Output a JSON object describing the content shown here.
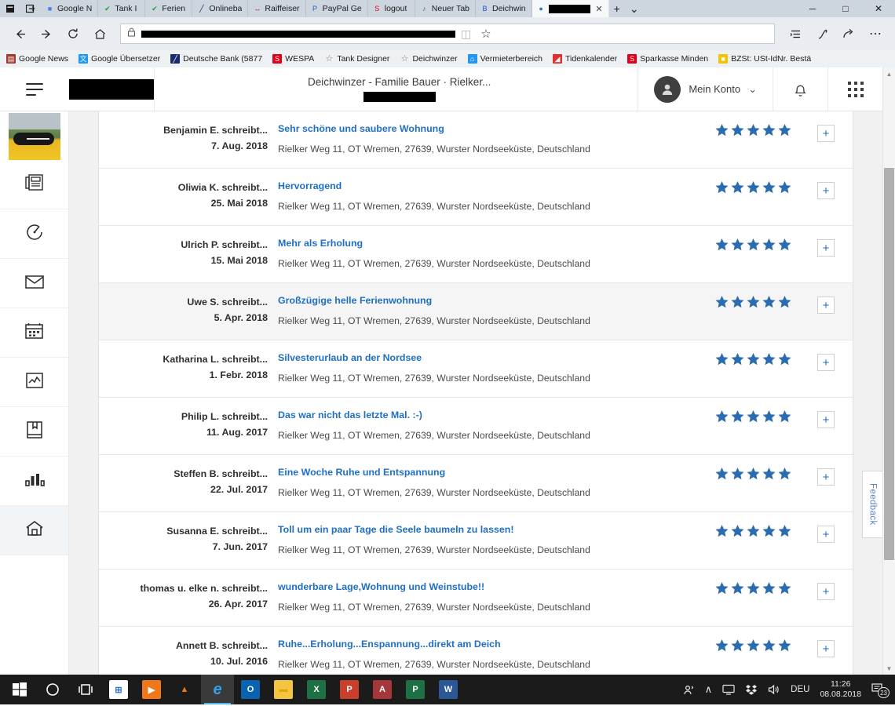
{
  "browser": {
    "tabs": [
      {
        "title": "Google N",
        "icon": "google-icon",
        "icon_color": "#4285f4",
        "glyph": "■",
        "active": false,
        "redacted": false
      },
      {
        "title": "Tank I",
        "icon": "checkmark-icon",
        "icon_color": "#1a9e3c",
        "glyph": "✔",
        "active": false,
        "redacted": false
      },
      {
        "title": "Ferien",
        "icon": "checkmark-icon",
        "icon_color": "#1a9e3c",
        "glyph": "✔",
        "active": false,
        "redacted": false
      },
      {
        "title": "Onlineba",
        "icon": "deutsche-bank-icon",
        "icon_color": "#1a2a6c",
        "glyph": "╱",
        "active": false,
        "redacted": false
      },
      {
        "title": "Raiffeiser",
        "icon": "raiffeisen-icon",
        "icon_color": "#c8102e",
        "glyph": "↔",
        "active": false,
        "redacted": false
      },
      {
        "title": "PayPal Ge",
        "icon": "paypal-icon",
        "icon_color": "#1565c0",
        "glyph": "P",
        "active": false,
        "redacted": false
      },
      {
        "title": "logout",
        "icon": "sparkasse-icon",
        "icon_color": "#e2001a",
        "glyph": "S",
        "active": false,
        "redacted": false
      },
      {
        "title": "Neuer Tab",
        "icon": "page-icon",
        "icon_color": "#5c5c5c",
        "glyph": "♪",
        "active": false,
        "redacted": false
      },
      {
        "title": "Deichwin",
        "icon": "booking-icon",
        "icon_color": "#1d4ed8",
        "glyph": "B",
        "active": false,
        "redacted": false
      },
      {
        "title": "",
        "icon": "redacted-icon",
        "icon_color": "#2b7bbd",
        "glyph": "●",
        "active": true,
        "redacted": true
      }
    ],
    "tab_close_glyph": "✕",
    "new_tab_glyph": "+",
    "tab_menu_glyph": "⌄",
    "window_controls": {
      "minimize": "─",
      "maximize": "□",
      "close": "✕"
    },
    "nav": {
      "back": "←",
      "forward": "→",
      "refresh": "↻",
      "home": "⌂",
      "lock_icon": "lock-icon",
      "url_redacted": true,
      "reading_view": "◫",
      "favorite": "☆",
      "reading_list": "☰",
      "notes": "✎",
      "share": "↱",
      "more": "⋯"
    },
    "bookmarks": [
      {
        "label": "Google News",
        "icon_color": "#9e3b2e",
        "glyph": "▤"
      },
      {
        "label": "Google Übersetzer",
        "icon_color": "#2196f3",
        "glyph": "文"
      },
      {
        "label": "Deutsche Bank (5877",
        "icon_color": "#1a2a6c",
        "glyph": "╱"
      },
      {
        "label": "WESPA",
        "icon_color": "#e2001a",
        "glyph": "S"
      },
      {
        "label": "Tank Designer",
        "icon_color": "#ffffff",
        "glyph": "☆"
      },
      {
        "label": "Deichwinzer",
        "icon_color": "#ffffff",
        "glyph": "☆"
      },
      {
        "label": "Vermieterbereich",
        "icon_color": "#2196f3",
        "glyph": "⌂"
      },
      {
        "label": "Tidenkalender",
        "icon_color": "#e03030",
        "glyph": "◢"
      },
      {
        "label": "Sparkasse Minden",
        "icon_color": "#e2001a",
        "glyph": "S"
      },
      {
        "label": "BZSt: USt-IdNr. Bestä",
        "icon_color": "#f5c400",
        "glyph": "■"
      }
    ]
  },
  "app": {
    "hamburger": "menu-icon",
    "brand_redacted": true,
    "header_title": "Deichwinzer - Familie Bauer · Rielker...",
    "header_subtitle_redacted": true,
    "account_label": "Mein Konto",
    "account_caret": "⌄",
    "bell_icon": "notification-bell-icon",
    "apps_icon": "apps-grid-icon"
  },
  "rail": {
    "items": [
      {
        "name": "thumbnail-preview",
        "icon": "property-thumbnail",
        "active": false
      },
      {
        "name": "news-feed",
        "icon": "newspaper-icon",
        "active": false
      },
      {
        "name": "activity",
        "icon": "speedometer-icon",
        "active": false
      },
      {
        "name": "messages",
        "icon": "envelope-icon",
        "active": false
      },
      {
        "name": "calendar",
        "icon": "calendar-icon",
        "active": false
      },
      {
        "name": "analytics",
        "icon": "line-chart-icon",
        "active": false
      },
      {
        "name": "bookings",
        "icon": "book-bookmark-icon",
        "active": false
      },
      {
        "name": "statistics",
        "icon": "bar-chart-icon",
        "active": false
      },
      {
        "name": "property",
        "icon": "home-icon",
        "active": true
      }
    ]
  },
  "reviews": {
    "address": "Rielker Weg 11, OT Wremen, 27639, Wurster Nordseeküste, Deutschland",
    "stars_max": 5,
    "add_button_glyph": "+",
    "rows": [
      {
        "author": "Benjamin E. schreibt...",
        "date": "7. Aug. 2018",
        "title": "Sehr schöne und saubere Wohnung",
        "stars": 5,
        "highlighted": false
      },
      {
        "author": "Oliwia K. schreibt...",
        "date": "25. Mai 2018",
        "title": "Hervorragend",
        "stars": 5,
        "highlighted": false
      },
      {
        "author": "Ulrich P. schreibt...",
        "date": "15. Mai 2018",
        "title": "Mehr als Erholung",
        "stars": 5,
        "highlighted": false
      },
      {
        "author": "Uwe S. schreibt...",
        "date": "5. Apr. 2018",
        "title": "Großzügige helle Ferienwohnung",
        "stars": 5,
        "highlighted": true
      },
      {
        "author": "Katharina L. schreibt...",
        "date": "1. Febr. 2018",
        "title": "Silvesterurlaub an der Nordsee",
        "stars": 5,
        "highlighted": false
      },
      {
        "author": "Philip L. schreibt...",
        "date": "11. Aug. 2017",
        "title": "Das war nicht das letzte Mal. :-)",
        "stars": 5,
        "highlighted": false
      },
      {
        "author": "Steffen B. schreibt...",
        "date": "22. Jul. 2017",
        "title": "Eine Woche Ruhe und Entspannung",
        "stars": 5,
        "highlighted": false
      },
      {
        "author": "Susanna E. schreibt...",
        "date": "7. Jun. 2017",
        "title": "Toll um ein paar Tage die Seele baumeln zu lassen!",
        "stars": 5,
        "highlighted": false
      },
      {
        "author": "thomas u. elke n. schreibt...",
        "date": "26. Apr. 2017",
        "title": "wunderbare Lage,Wohnung und Weinstube!!",
        "stars": 5,
        "highlighted": false
      },
      {
        "author": "Annett B. schreibt...",
        "date": "10. Jul. 2016",
        "title": "Ruhe...Erholung...Enspannung...direkt am Deich",
        "stars": 5,
        "highlighted": false
      }
    ]
  },
  "feedback": {
    "label": "Feedback"
  },
  "taskbar": {
    "start": "windows-start-icon",
    "search": "search-circle-icon",
    "taskview": "task-view-icon",
    "apps": [
      {
        "name": "microsoft-store",
        "label": "Ὥ2",
        "color": "#ffffff",
        "glyph": "⊞",
        "fg": "#2b6fc9"
      },
      {
        "name": "media-player",
        "label": "",
        "color": "#f07818",
        "glyph": "▶",
        "fg": "#ffffff"
      },
      {
        "name": "vlc-player",
        "label": "",
        "color": "#1b1b1b",
        "glyph": "▲",
        "fg": "#f07818"
      },
      {
        "name": "microsoft-edge",
        "label": "",
        "color": "#0a6dc1",
        "glyph": "e",
        "fg": "#ffffff"
      },
      {
        "name": "outlook",
        "label": "",
        "color": "#0a63b0",
        "glyph": "O",
        "fg": "#ffffff"
      },
      {
        "name": "file-explorer",
        "label": "",
        "color": "#f5c542",
        "glyph": "▬",
        "fg": "#e0a800"
      },
      {
        "name": "excel",
        "label": "X",
        "color": "#1d7044",
        "glyph": "X",
        "fg": "#ffffff"
      },
      {
        "name": "publisher",
        "label": "P",
        "color": "#c8402c",
        "glyph": "P",
        "fg": "#ffffff"
      },
      {
        "name": "access",
        "label": "A",
        "color": "#a4373a",
        "glyph": "A",
        "fg": "#ffffff"
      },
      {
        "name": "powerpoint",
        "label": "P",
        "color": "#1d7044",
        "glyph": "P",
        "fg": "#ffffff"
      },
      {
        "name": "word",
        "label": "W",
        "color": "#2b5797",
        "glyph": "W",
        "fg": "#ffffff"
      }
    ],
    "tray": {
      "people": "people-icon",
      "chevron": "∧",
      "display": "monitor-icon",
      "dropbox": "dropbox-icon",
      "volume": "ὐa",
      "language": "DEU",
      "time": "11:26",
      "date": "08.08.2018",
      "notification_count": "23"
    }
  }
}
